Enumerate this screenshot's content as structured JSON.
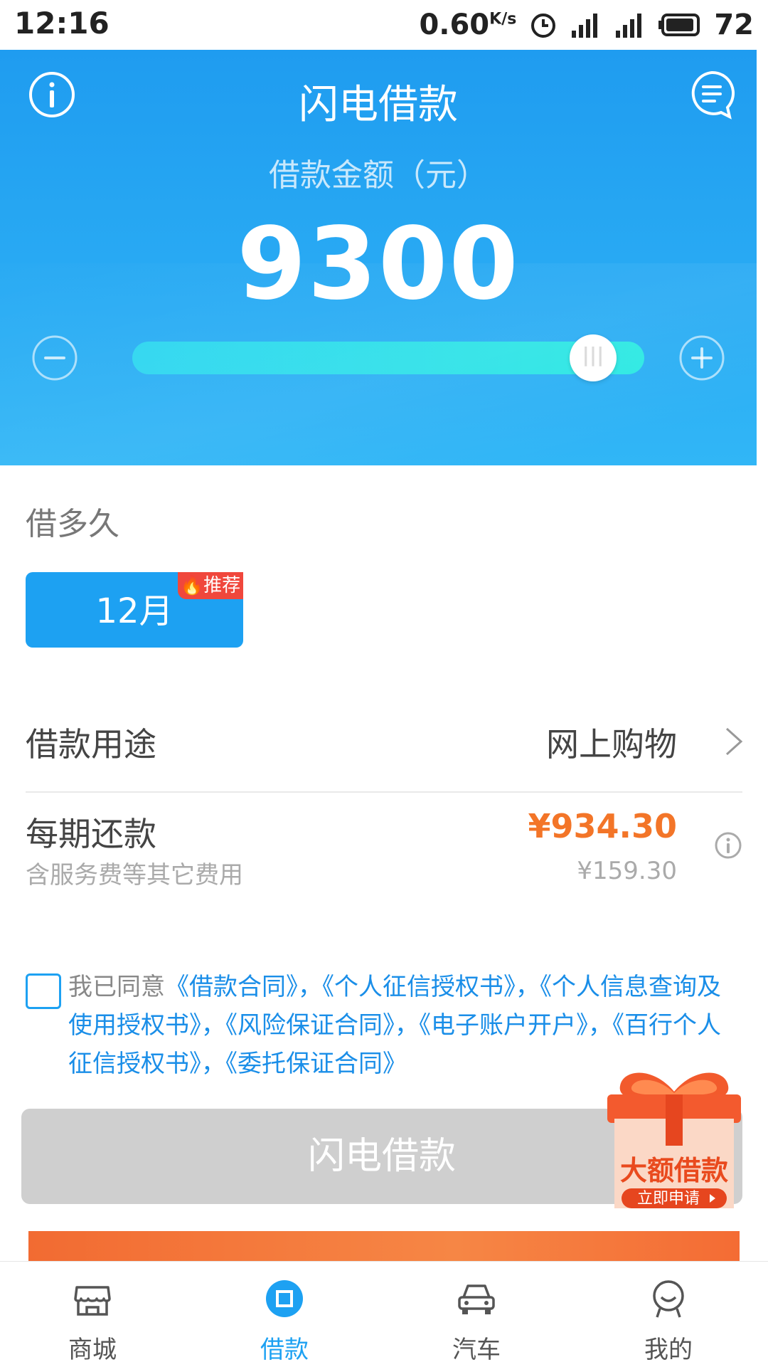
{
  "status_bar": {
    "time": "12:16",
    "speed": "0.60",
    "speed_unit": "K/s",
    "battery": "72"
  },
  "header": {
    "title": "闪电借款",
    "amount_label": "借款金额（元）",
    "amount_value": "9300",
    "slider_level": 0.9
  },
  "term": {
    "label": "借多久",
    "selected": "12月",
    "badge": "推荐"
  },
  "purpose": {
    "label": "借款用途",
    "value": "网上购物"
  },
  "repayment": {
    "label": "每期还款",
    "sub": "含服务费等其它费用",
    "amount": "¥934.30",
    "secondary_amount": "¥159.30"
  },
  "agreement": {
    "prefix": "我已同意",
    "links": [
      "《借款合同》",
      "《个人征信授权书》",
      "《个人信息查询及使用授权书》",
      "《风险保证合同》",
      "《电子账户开户》",
      "《百行个人征信授权书》",
      "《委托保证合同》"
    ],
    "sep": "，"
  },
  "apply_button": "闪电借款",
  "promo": {
    "title": "大额借款",
    "cta": "立即申请"
  },
  "tabs": [
    {
      "label": "商城",
      "icon": "store-icon"
    },
    {
      "label": "借款",
      "icon": "loan-icon"
    },
    {
      "label": "汽车",
      "icon": "car-icon"
    },
    {
      "label": "我的",
      "icon": "profile-icon"
    }
  ],
  "colors": {
    "primary": "#1da1f2",
    "accent": "#f37528",
    "badge": "#f0473c"
  }
}
